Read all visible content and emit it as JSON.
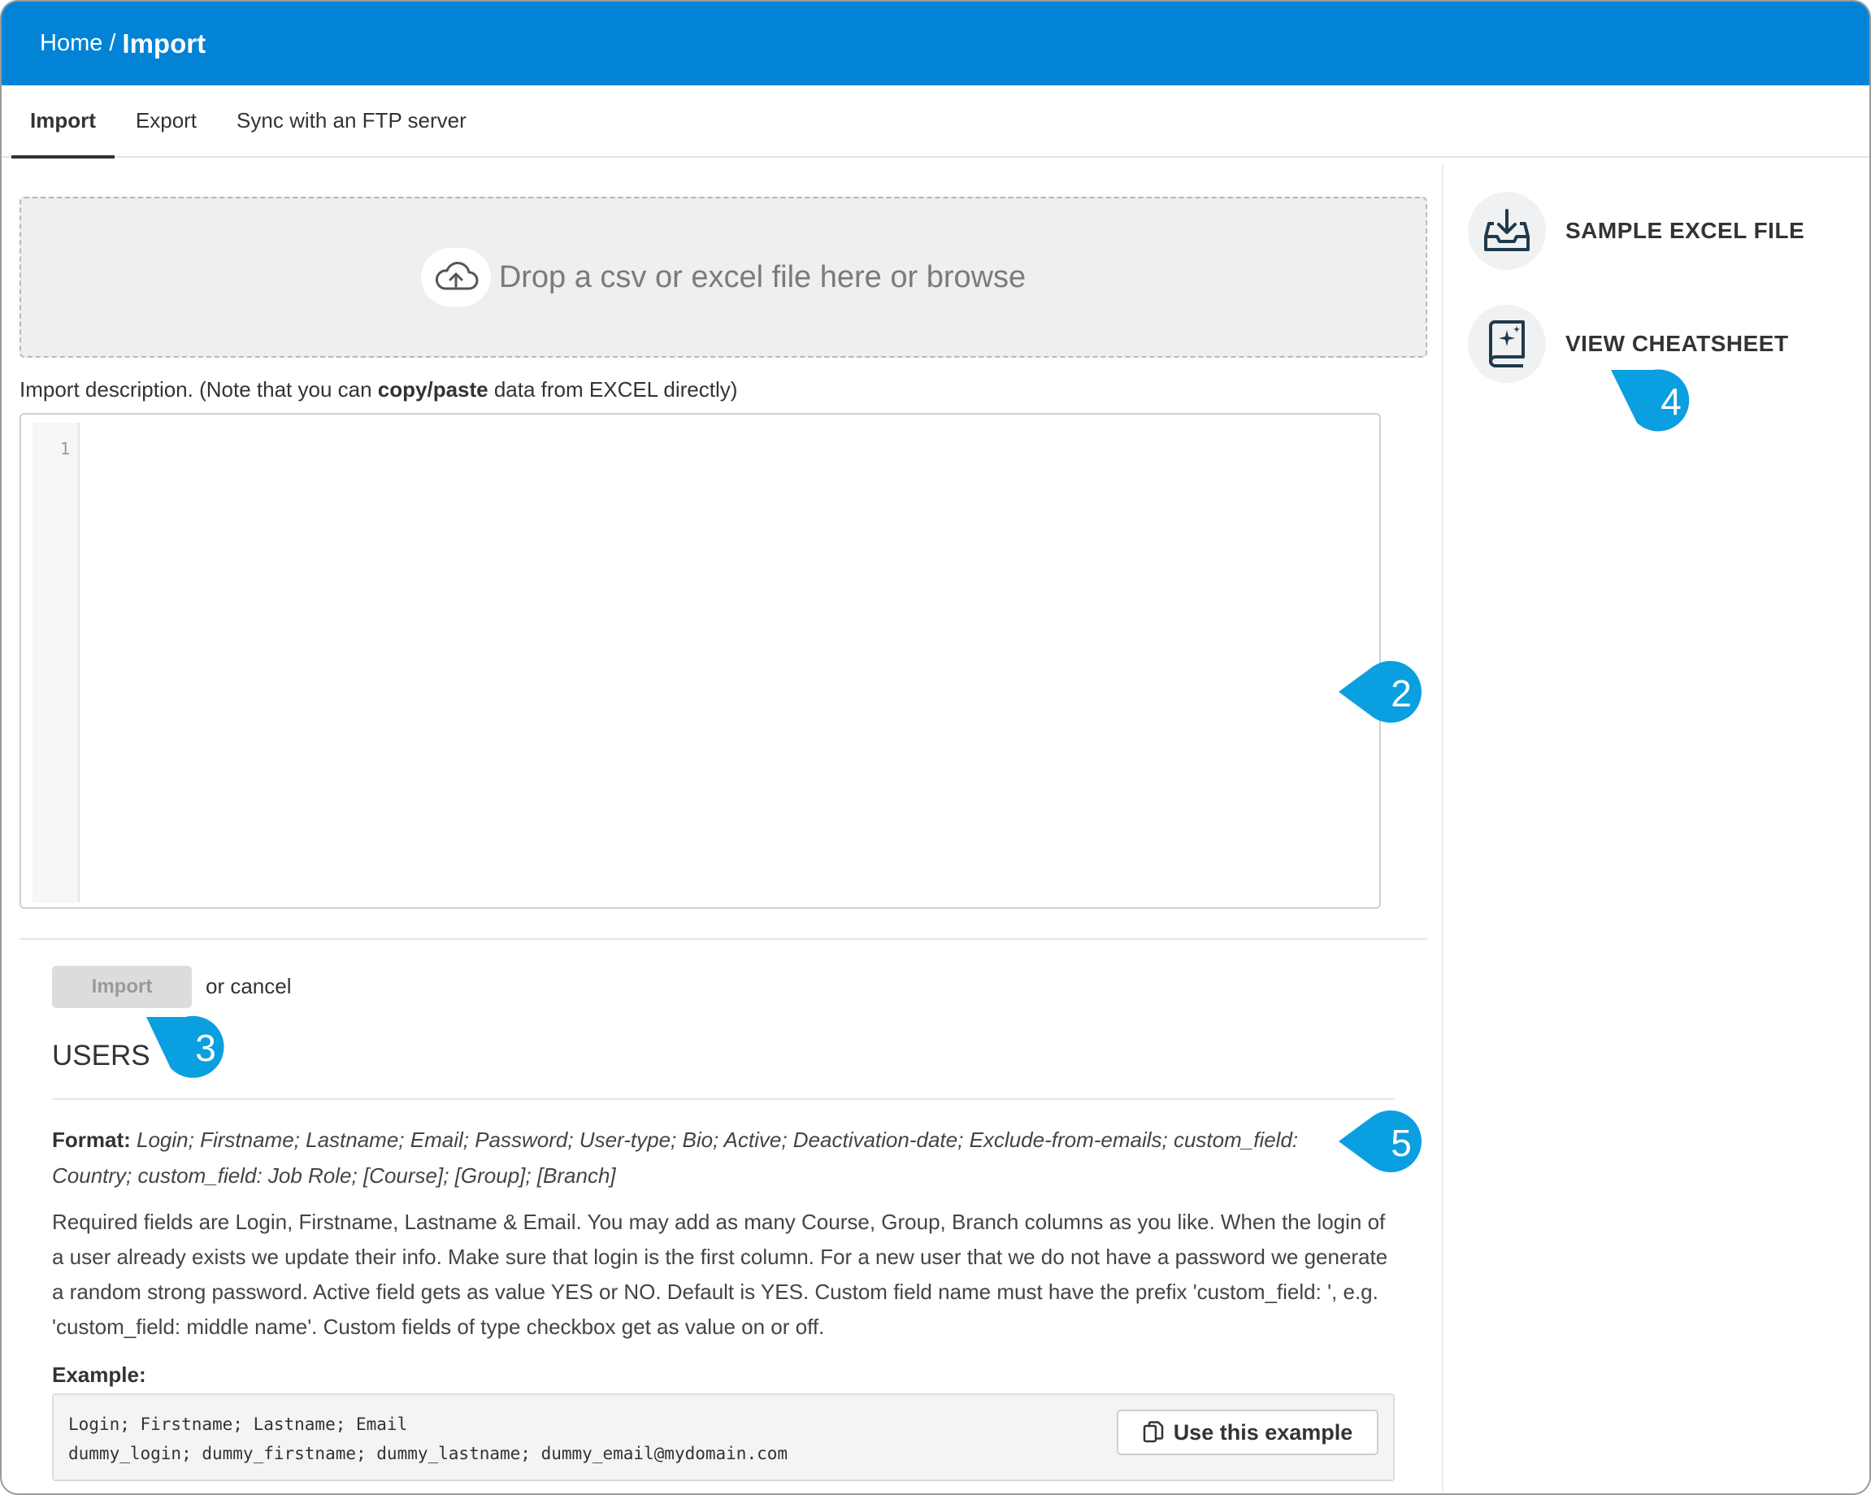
{
  "breadcrumb": {
    "home": "Home",
    "separator": "/",
    "current": "Import"
  },
  "tabs": [
    {
      "label": "Import",
      "active": true
    },
    {
      "label": "Export",
      "active": false
    },
    {
      "label": "Sync with an FTP server",
      "active": false
    }
  ],
  "dropzone": {
    "text": "Drop a csv or excel file here or browse",
    "icon": "cloud-upload-icon"
  },
  "description": {
    "label_prefix": "Import description. (Note that you can ",
    "label_bold": "copy/paste",
    "label_suffix": " data from EXCEL directly)",
    "line_number": "1",
    "value": ""
  },
  "actions": {
    "import_label": "Import",
    "or_text": "or ",
    "cancel_label": "cancel"
  },
  "users": {
    "heading": "USERS",
    "format_label": "Format:",
    "format_value": "Login; Firstname; Lastname; Email; Password; User-type; Bio; Active; Deactivation-date; Exclude-from-emails; custom_field: Country; custom_field: Job Role; [Course]; [Group]; [Branch]",
    "required_text": "Required fields are Login, Firstname, Lastname & Email. You may add as many Course, Group, Branch columns as you like. When the login of a user already exists we update their info. Make sure that login is the first column. For a new user that we do not have a password we generate a random strong password. Active field gets as value YES or NO. Default is YES. Custom field name must have the prefix 'custom_field: ', e.g. 'custom_field: middle name'. Custom fields of type checkbox get as value on or off.",
    "example_label": "Example:",
    "example_code": "Login; Firstname; Lastname; Email\ndummy_login; dummy_firstname; dummy_lastname; dummy_email@mydomain.com",
    "use_example_label": "Use this example"
  },
  "sidebar": {
    "sample_label": "SAMPLE EXCEL FILE",
    "sample_icon": "download-tray-icon",
    "cheatsheet_label": "VIEW CHEATSHEET",
    "cheatsheet_icon": "book-sparkle-icon"
  },
  "callouts": [
    "2",
    "3",
    "4",
    "5"
  ],
  "colors": {
    "header": "#0283d6",
    "callout": "#0a9fe0"
  }
}
